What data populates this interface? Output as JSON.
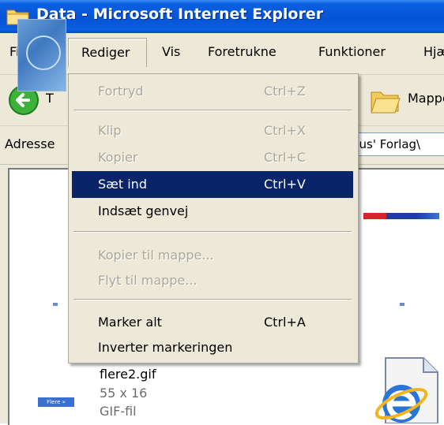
{
  "window": {
    "title": "Data - Microsoft Internet Explorer"
  },
  "menubar": {
    "items": [
      "Filer",
      "Rediger",
      "Vis",
      "Foretrukne",
      "Funktioner",
      "Hjælp"
    ],
    "active": "Rediger"
  },
  "toolbar": {
    "back_label": "T",
    "folders_label": "Mapper"
  },
  "address": {
    "label": "Adresse",
    "value": "hus' Forlag\\"
  },
  "edit_menu": {
    "items": [
      {
        "label": "Fortryd",
        "shortcut": "Ctrl+Z",
        "enabled": false
      },
      {
        "label": "Klip",
        "shortcut": "Ctrl+X",
        "enabled": false
      },
      {
        "label": "Kopier",
        "shortcut": "Ctrl+C",
        "enabled": false
      },
      {
        "label": "Sæt ind",
        "shortcut": "Ctrl+V",
        "enabled": true,
        "highlighted": true
      },
      {
        "label": "Indsæt genvej",
        "shortcut": "",
        "enabled": true
      },
      {
        "label": "Kopier til mappe...",
        "shortcut": "",
        "enabled": false
      },
      {
        "label": "Flyt til mappe...",
        "shortcut": "",
        "enabled": false
      },
      {
        "label": "Marker alt",
        "shortcut": "Ctrl+A",
        "enabled": true
      },
      {
        "label": "Inverter markeringen",
        "shortcut": "",
        "enabled": true
      }
    ]
  },
  "files": {
    "selected": {
      "name": "flere2.gif",
      "dims": "55 x 16",
      "type": "GIF-fil",
      "thumb_text": "Flere »"
    }
  },
  "colors": {
    "titlebar": "#0554d6",
    "menu_bg": "#ece9d8",
    "highlight": "#0a246a",
    "disabled": "#aca899"
  },
  "icons": {
    "title": "folder-icon",
    "back": "back-arrow-icon",
    "folders": "folders-icon",
    "ie": "internet-explorer-icon"
  }
}
